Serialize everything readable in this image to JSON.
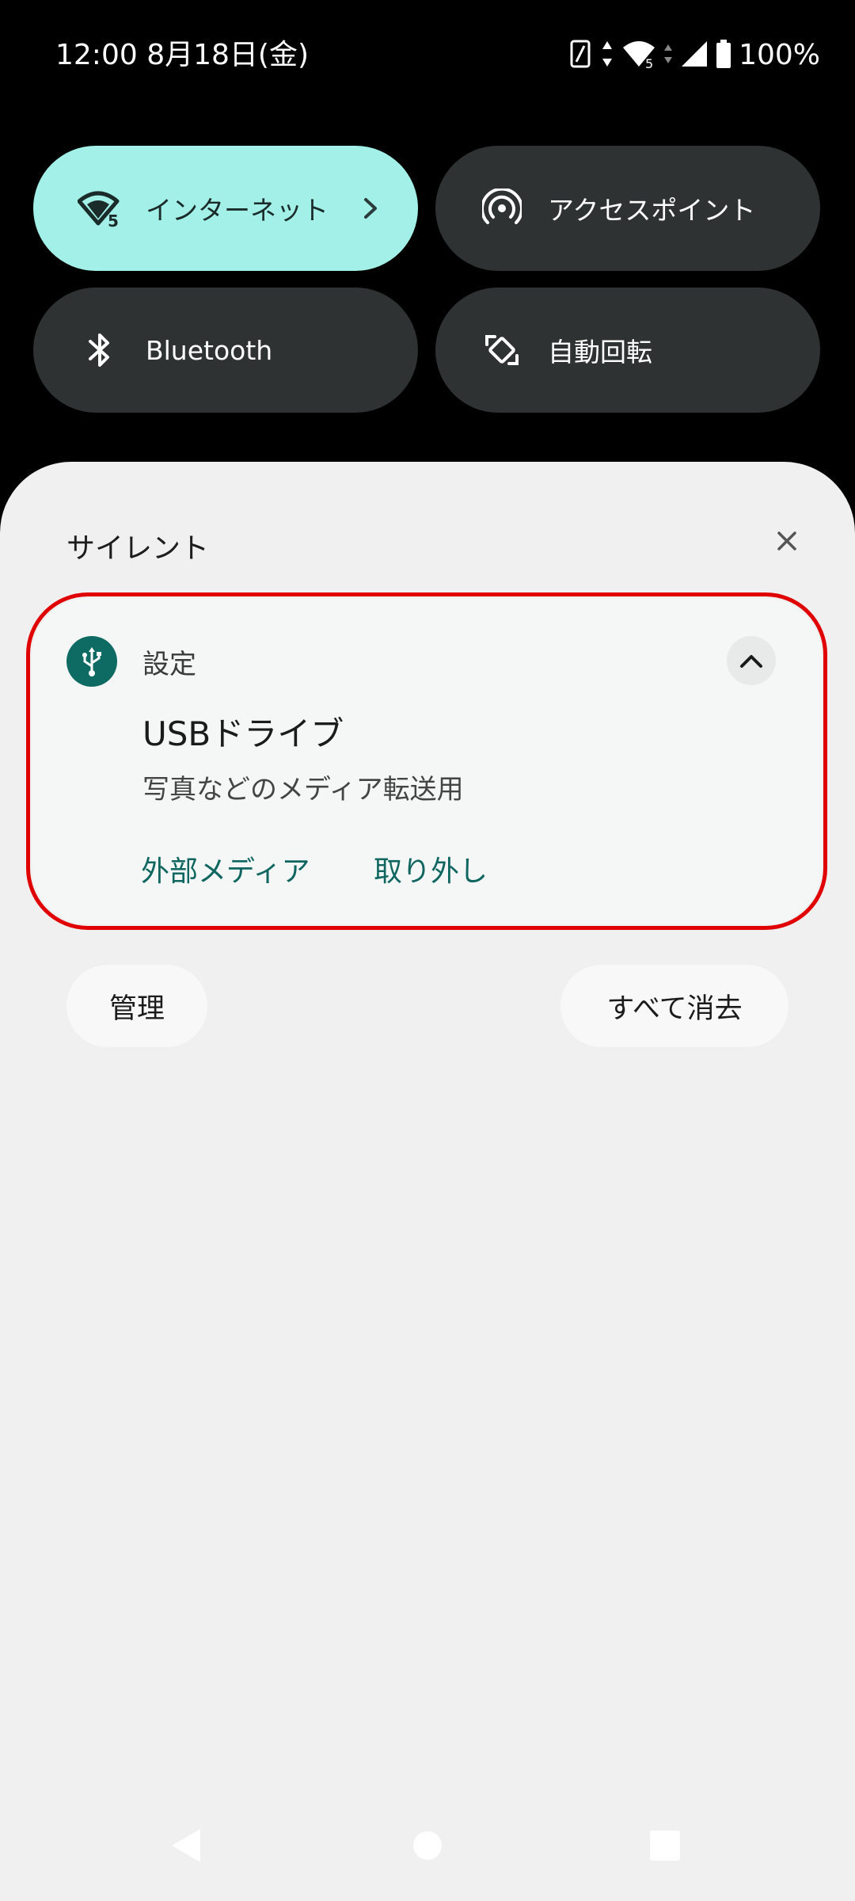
{
  "status_bar": {
    "time_date": "12:00 8月18日(金)",
    "battery": "100%"
  },
  "quick_tiles": [
    {
      "label": "インターネット",
      "icon": "wifi-5g-icon",
      "active": true
    },
    {
      "label": "アクセスポイント",
      "icon": "hotspot-icon",
      "active": false
    },
    {
      "label": "Bluetooth",
      "icon": "bluetooth-icon",
      "active": false
    },
    {
      "label": "自動回転",
      "icon": "auto-rotate-icon",
      "active": false
    }
  ],
  "shade": {
    "section_label": "サイレント",
    "notification": {
      "app_name": "設定",
      "title": "USBドライブ",
      "text": "写真などのメディア転送用",
      "actions": [
        "外部メディア",
        "取り外し"
      ]
    },
    "manage_label": "管理",
    "clear_all_label": "すべて消去"
  },
  "colors": {
    "active_tile": "#a3f0e8",
    "tile_dark": "#2f3232",
    "accent": "#0f6660",
    "highlight": "#e10000"
  }
}
